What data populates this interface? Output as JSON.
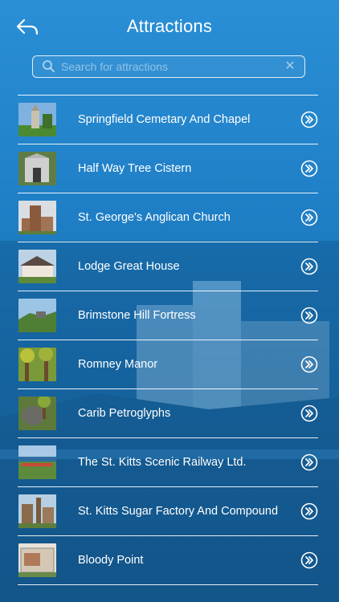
{
  "header": {
    "title": "Attractions",
    "back_icon": "back-arrow-icon"
  },
  "search": {
    "placeholder": "Search for attractions",
    "value": ""
  },
  "colors": {
    "accent": "#1f7fc6",
    "text": "#ffffff"
  },
  "attractions": [
    {
      "label": "Springfield Cemetary And Chapel"
    },
    {
      "label": "Half Way Tree Cistern"
    },
    {
      "label": "St. George's Anglican Church"
    },
    {
      "label": "Lodge Great House"
    },
    {
      "label": "Brimstone Hill Fortress"
    },
    {
      "label": "Romney Manor"
    },
    {
      "label": "Carib Petroglyphs"
    },
    {
      "label": "The St. Kitts Scenic Railway Ltd."
    },
    {
      "label": "St. Kitts Sugar Factory And Compound"
    },
    {
      "label": "Bloody Point"
    }
  ]
}
